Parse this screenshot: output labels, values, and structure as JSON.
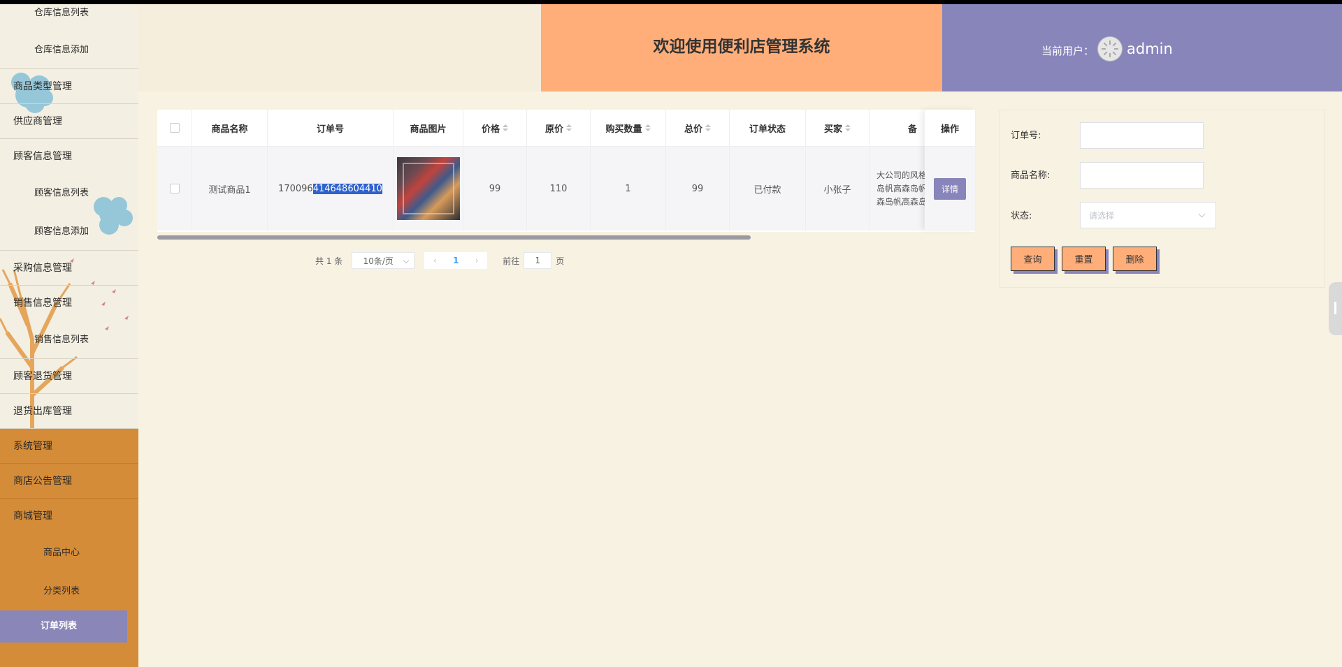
{
  "sidebar": {
    "items": [
      {
        "label": "仓库信息列表",
        "type": "sub"
      },
      {
        "label": "仓库信息添加",
        "type": "sub"
      },
      {
        "label": "商品类型管理",
        "type": "top"
      },
      {
        "label": "供应商管理",
        "type": "top"
      },
      {
        "label": "顾客信息管理",
        "type": "top"
      },
      {
        "label": "顾客信息列表",
        "type": "sub"
      },
      {
        "label": "顾客信息添加",
        "type": "sub"
      },
      {
        "label": "采购信息管理",
        "type": "top"
      },
      {
        "label": "销售信息管理",
        "type": "top"
      },
      {
        "label": "销售信息列表",
        "type": "sub"
      },
      {
        "label": "顾客退货管理",
        "type": "top"
      },
      {
        "label": "退货出库管理",
        "type": "top"
      },
      {
        "label": "系统管理",
        "type": "top"
      },
      {
        "label": "商店公告管理",
        "type": "top"
      },
      {
        "label": "商城管理",
        "type": "top"
      },
      {
        "label": "商品中心",
        "type": "sub"
      },
      {
        "label": "分类列表",
        "type": "sub"
      },
      {
        "label": "订单列表",
        "type": "sub-active"
      }
    ]
  },
  "header": {
    "title": "欢迎使用便利店管理系统",
    "user_label": "当前用户：",
    "username": "admin"
  },
  "table": {
    "columns": [
      "商品名称",
      "订单号",
      "商品图片",
      "价格",
      "原价",
      "购买数量",
      "总价",
      "订单状态",
      "买家",
      "备",
      "操作"
    ],
    "rows": [
      {
        "name": "测试商品1",
        "order_no_prefix": "17009",
        "order_no_mid": "6",
        "order_no_selected": "414648604410",
        "price": "99",
        "original_price": "110",
        "quantity": "1",
        "total": "99",
        "status": "已付款",
        "buyer": "小张子",
        "note": "大公司的风格\n岛帆高森岛帆\n森岛帆高森岛",
        "action": "详情"
      }
    ]
  },
  "pagination": {
    "total": "共 1 条",
    "page_size": "10条/页",
    "current": "1",
    "goto_label": "前往",
    "goto_value": "1",
    "page_suffix": "页"
  },
  "search": {
    "order_no_label": "订单号:",
    "name_label": "商品名称:",
    "status_label": "状态:",
    "status_placeholder": "请选择",
    "query": "查询",
    "reset": "重置",
    "delete": "删除"
  },
  "colors": {
    "title_bg": "#ffae7a",
    "user_bg": "#8885bb",
    "sidebar_orange": "#d58c38",
    "page_bg": "#f8f2e2"
  }
}
